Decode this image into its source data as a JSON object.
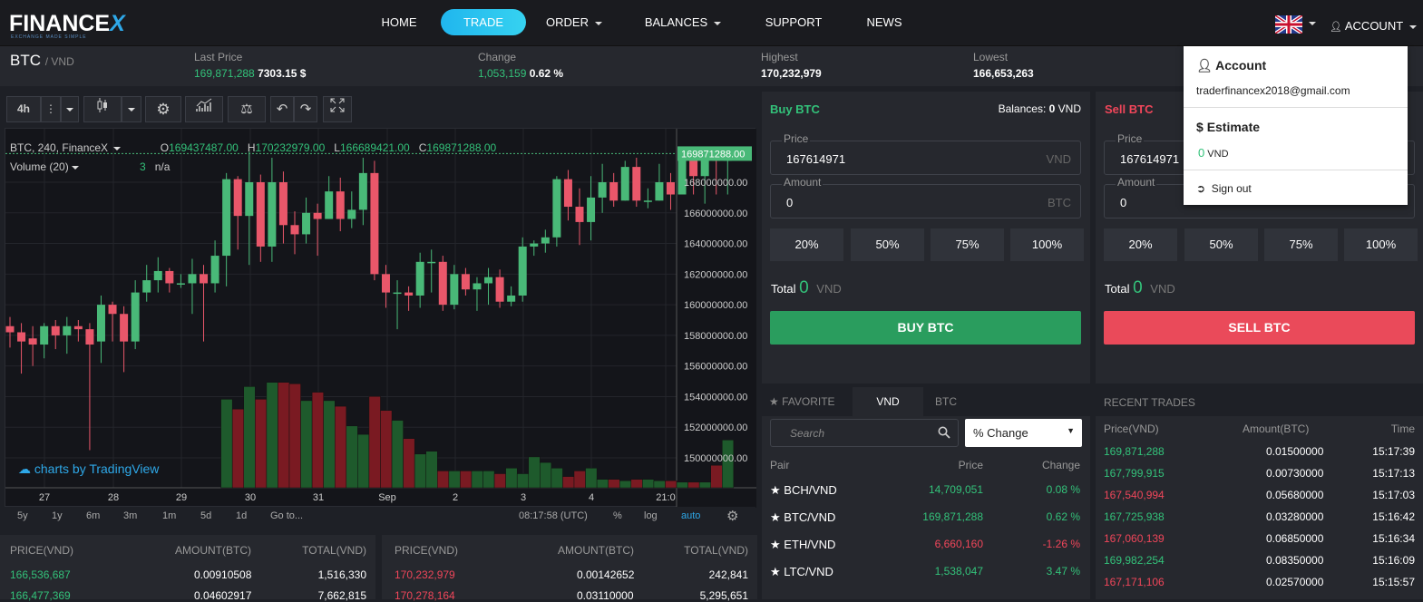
{
  "nav": {
    "logo": "FINANCE",
    "logo_x": "X",
    "logo_tagline": "EXCHANGE MADE SIMPLE",
    "items": [
      "HOME",
      "TRADE",
      "ORDER",
      "BALANCES",
      "SUPPORT",
      "NEWS"
    ],
    "account_label": "ACCOUNT"
  },
  "ticker": {
    "pair": "BTC",
    "quote": "/ VND",
    "last_price_label": "Last Price",
    "last_price": "169,871,288",
    "last_price_usd": "7303.15 $",
    "change_label": "Change",
    "change_value": "1,053,159",
    "change_pct": "0.62 %",
    "highest_label": "Highest",
    "highest": "170,232,979",
    "lowest_label": "Lowest",
    "lowest": "166,653,263"
  },
  "chart_toolbar": {
    "interval": "4h"
  },
  "chart_legend": {
    "symbol": "BTC, 240, FinanceX",
    "o_label": "O",
    "o": "169437487.00",
    "h_label": "H",
    "h": "170232979.00",
    "l_label": "L",
    "l": "166689421.00",
    "c_label": "C",
    "c": "169871288.00",
    "volume": "Volume (20)",
    "volume_val": "3",
    "volume_na": "n/a",
    "watermark": "charts by TradingView",
    "price_marker": "169871288.00"
  },
  "chart_data": {
    "type": "candlestick",
    "y_ticks": [
      "168000000.00",
      "166000000.00",
      "164000000.00",
      "162000000.00",
      "160000000.00",
      "158000000.00",
      "156000000.00",
      "154000000.00",
      "152000000.00",
      "150000000.00"
    ],
    "x_ticks": [
      "27",
      "28",
      "29",
      "30",
      "31",
      "Sep",
      "2",
      "3",
      "4",
      "21:0"
    ],
    "candles": [
      [
        158.6,
        158.2,
        159.2,
        157.2
      ],
      [
        158.2,
        157.6,
        158.8,
        155.5
      ],
      [
        157.8,
        157.4,
        158.6,
        156.0
      ],
      [
        157.4,
        158.6,
        158.8,
        156.5
      ],
      [
        158.6,
        158.0,
        159.0,
        157.1
      ],
      [
        158.0,
        158.6,
        159.2,
        156.8
      ],
      [
        158.6,
        158.4,
        159.0,
        157.6
      ],
      [
        158.4,
        157.4,
        158.8,
        150.5
      ],
      [
        157.6,
        160.0,
        160.6,
        156.2
      ],
      [
        160.0,
        159.4,
        160.2,
        157.6
      ],
      [
        159.4,
        157.6,
        159.9,
        155.6
      ],
      [
        157.6,
        160.8,
        161.6,
        157.1
      ],
      [
        160.8,
        161.6,
        162.6,
        160.2
      ],
      [
        161.6,
        162.2,
        163.1,
        160.8
      ],
      [
        162.2,
        161.4,
        162.4,
        160.8
      ],
      [
        161.4,
        161.4,
        162.0,
        161.1
      ],
      [
        161.4,
        162.0,
        163.0,
        159.4
      ],
      [
        162.0,
        161.4,
        162.6,
        157.6
      ],
      [
        161.4,
        163.2,
        164.2,
        160.8
      ],
      [
        163.2,
        168.2,
        168.6,
        161.2
      ],
      [
        168.2,
        165.8,
        168.4,
        163.6
      ],
      [
        165.8,
        168.0,
        170.0,
        162.6
      ],
      [
        168.0,
        163.8,
        168.5,
        162.8
      ],
      [
        163.8,
        168.0,
        169.6,
        162.8
      ],
      [
        168.0,
        165.2,
        168.7,
        164.0
      ],
      [
        165.2,
        164.6,
        166.1,
        163.3
      ],
      [
        164.6,
        166.0,
        167.0,
        164.0
      ],
      [
        166.0,
        165.6,
        166.6,
        163.2
      ],
      [
        165.6,
        167.4,
        168.4,
        165.6
      ],
      [
        167.4,
        165.6,
        168.3,
        164.8
      ],
      [
        165.6,
        166.2,
        167.4,
        165.0
      ],
      [
        166.2,
        168.6,
        169.6,
        165.2
      ],
      [
        168.6,
        162.0,
        169.4,
        161.6
      ],
      [
        162.0,
        160.8,
        162.6,
        159.8
      ],
      [
        160.8,
        160.8,
        161.6,
        158.4
      ],
      [
        160.8,
        160.6,
        161.2,
        159.6
      ],
      [
        160.6,
        162.8,
        163.4,
        159.8
      ],
      [
        162.8,
        162.8,
        163.6,
        160.8
      ],
      [
        162.8,
        160.0,
        163.2,
        159.6
      ],
      [
        160.0,
        162.0,
        162.6,
        159.7
      ],
      [
        162.0,
        161.0,
        162.4,
        160.6
      ],
      [
        161.0,
        161.4,
        161.8,
        159.6
      ],
      [
        161.4,
        161.8,
        162.4,
        160.0
      ],
      [
        161.8,
        160.2,
        162.3,
        159.8
      ],
      [
        160.2,
        160.6,
        161.2,
        159.9
      ],
      [
        160.6,
        163.8,
        164.4,
        160.2
      ],
      [
        163.8,
        164.0,
        164.2,
        163.2
      ],
      [
        164.0,
        164.4,
        164.9,
        163.4
      ],
      [
        164.4,
        168.2,
        168.4,
        163.8
      ],
      [
        168.2,
        166.4,
        168.8,
        165.5
      ],
      [
        166.4,
        165.4,
        167.6,
        163.9
      ],
      [
        165.4,
        167.0,
        168.4,
        164.2
      ],
      [
        167.0,
        168.0,
        169.2,
        166.0
      ],
      [
        168.0,
        166.8,
        168.6,
        166.4
      ],
      [
        166.8,
        169.0,
        169.4,
        166.8
      ],
      [
        169.0,
        166.8,
        169.6,
        166.4
      ],
      [
        166.8,
        166.8,
        167.6,
        166.3
      ],
      [
        166.8,
        168.0,
        169.2,
        166.8
      ],
      [
        168.0,
        167.2,
        168.6,
        166.2
      ],
      [
        167.2,
        169.8,
        170.1,
        167.3
      ],
      [
        169.8,
        168.4,
        170.2,
        167.2
      ],
      [
        168.4,
        169.6,
        170.3,
        166.6
      ],
      [
        169.6,
        169.4,
        170.0,
        167.2
      ],
      [
        169.4,
        169.9,
        170.2,
        167.2
      ]
    ],
    "volumes": [
      0,
      0,
      0,
      0,
      0,
      0,
      0,
      0,
      0,
      0,
      0,
      0,
      0,
      0,
      0,
      0,
      0,
      0,
      0,
      0.63,
      0.56,
      0.72,
      0.63,
      0.75,
      0.75,
      0.74,
      0.62,
      0.68,
      0.62,
      0.58,
      0.44,
      0.38,
      0.65,
      0.55,
      0.48,
      0.35,
      0.24,
      0.26,
      0.12,
      0.12,
      0.12,
      0.12,
      0.12,
      0.1,
      0.14,
      0.1,
      0.22,
      0.18,
      0.14,
      0.08,
      0.12,
      0.14,
      0.06,
      0.06,
      0.05,
      0.06,
      0.06,
      0.05,
      0.05,
      0.04,
      0.04,
      0.04,
      0.16,
      0.34
    ],
    "y_range": [
      149000000,
      171000000
    ]
  },
  "time_bar": {
    "ranges": [
      "5y",
      "1y",
      "6m",
      "3m",
      "1m",
      "5d",
      "1d",
      "Go to..."
    ],
    "clock": "08:17:58",
    "tz": "(UTC)",
    "pct": "%",
    "log": "log",
    "auto": "auto"
  },
  "buy": {
    "title": "Buy BTC",
    "balances_label": "Balances:",
    "balances_value": "0",
    "balances_unit": "VND",
    "price_label": "Price",
    "price": "167614971",
    "price_unit": "VND",
    "amount_label": "Amount",
    "amount": "0",
    "amount_unit": "BTC",
    "pcts": [
      "20%",
      "50%",
      "75%",
      "100%"
    ],
    "total_label": "Total",
    "total": "0",
    "total_unit": "VND",
    "button": "BUY BTC"
  },
  "sell": {
    "title": "Sell BTC",
    "price_label": "Price",
    "price": "167614971",
    "amount_label": "Amount",
    "amount": "0",
    "pcts": [
      "20%",
      "50%",
      "75%",
      "100%"
    ],
    "total_label": "Total",
    "total": "0",
    "total_unit": "VND",
    "button": "SELL BTC"
  },
  "market": {
    "tabs": [
      "FAVORITE",
      "VND",
      "BTC"
    ],
    "search_placeholder": "Search",
    "sort": "% Change",
    "head": [
      "Pair",
      "Price",
      "Change"
    ],
    "rows": [
      {
        "pair": "BCH/VND",
        "price": "14,709,051",
        "change": "0.08 %",
        "dir": "up"
      },
      {
        "pair": "BTC/VND",
        "price": "169,871,288",
        "change": "0.62 %",
        "dir": "up"
      },
      {
        "pair": "ETH/VND",
        "price": "6,660,160",
        "change": "-1.26 %",
        "dir": "down"
      },
      {
        "pair": "LTC/VND",
        "price": "1,538,047",
        "change": "3.47 %",
        "dir": "up"
      }
    ]
  },
  "recent": {
    "title": "RECENT TRADES",
    "head": [
      "Price(VND)",
      "Amount(BTC)",
      "Time"
    ],
    "rows": [
      {
        "price": "169,871,288",
        "amount": "0.01500000",
        "time": "15:17:39",
        "dir": "up"
      },
      {
        "price": "167,799,915",
        "amount": "0.00730000",
        "time": "15:17:13",
        "dir": "up"
      },
      {
        "price": "167,540,994",
        "amount": "0.05680000",
        "time": "15:17:03",
        "dir": "down"
      },
      {
        "price": "167,725,938",
        "amount": "0.03280000",
        "time": "15:16:42",
        "dir": "up"
      },
      {
        "price": "167,060,139",
        "amount": "0.06850000",
        "time": "15:16:34",
        "dir": "down"
      },
      {
        "price": "169,982,254",
        "amount": "0.08350000",
        "time": "15:16:09",
        "dir": "up"
      },
      {
        "price": "167,171,106",
        "amount": "0.02570000",
        "time": "15:15:57",
        "dir": "down"
      }
    ]
  },
  "orderbook_buy": {
    "head": [
      "PRICE(VND)",
      "AMOUNT(BTC)",
      "TOTAL(VND)"
    ],
    "rows": [
      {
        "price": "166,536,687",
        "amount": "0.00910508",
        "total": "1,516,330"
      },
      {
        "price": "166,477,369",
        "amount": "0.04602917",
        "total": "7,662,815"
      }
    ]
  },
  "orderbook_sell": {
    "head": [
      "PRICE(VND)",
      "AMOUNT(BTC)",
      "TOTAL(VND)"
    ],
    "rows": [
      {
        "price": "170,232,979",
        "amount": "0.00142652",
        "total": "242,841"
      },
      {
        "price": "170,278,164",
        "amount": "0.03110000",
        "total": "5,295,651"
      }
    ]
  },
  "account_menu": {
    "title": "Account",
    "email": "traderfinancex2018@gmail.com",
    "estimate_title": "Estimate",
    "estimate_value": "0",
    "estimate_unit": "VND",
    "signout": "Sign out"
  },
  "colors": {
    "green": "#33c27a",
    "red": "#f0465a",
    "accent": "#20b6ee",
    "buy_button": "#2a9d5e",
    "sell_button": "#ea4a5a"
  }
}
